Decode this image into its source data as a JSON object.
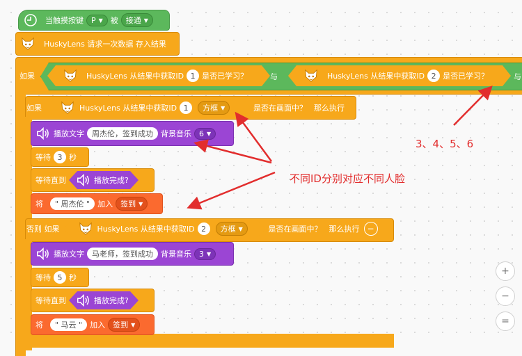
{
  "event_block": {
    "prefix": "当触摸按键",
    "key": "P",
    "middle": "被",
    "state": "接通"
  },
  "request_block": {
    "label": "HuskyLens 请求一次数据 存入结果"
  },
  "outer_if": {
    "if_label": "如果",
    "cond1": {
      "label": "HuskyLens 从结果中获取ID",
      "id": "1",
      "suffix": "是否已学习？"
    },
    "and_label": "与",
    "cond2": {
      "label": "HuskyLens 从结果中获取ID",
      "id": "2",
      "suffix": "是否已学习？"
    },
    "and_label_2": "与"
  },
  "inner_if": {
    "if_label": "如果",
    "label": "HuskyLens 从结果中获取ID",
    "id": "1",
    "shape": "方框",
    "suffix": "是否在画面中？",
    "then": "那么执行"
  },
  "play1": {
    "label": "播放文字",
    "text": "周杰伦，签到成功",
    "music_label": "背景音乐",
    "music": "6"
  },
  "wait1": {
    "label": "等待",
    "value": "3",
    "unit": "秒"
  },
  "wait_until1": {
    "label": "等待直到",
    "cond": "播放完成?"
  },
  "add1": {
    "label": "将",
    "value": "\" 周杰伦 \"",
    "join": "加入",
    "list": "签到"
  },
  "else_if": {
    "label_prefix": "否则 如果",
    "label": "HuskyLens 从结果中获取ID",
    "id": "2",
    "shape": "方框",
    "suffix": "是否在画面中？",
    "then": "那么执行"
  },
  "play2": {
    "label": "播放文字",
    "text": "马老师，签到成功",
    "music_label": "背景音乐",
    "music": "3"
  },
  "wait2": {
    "label": "等待",
    "value": "5",
    "unit": "秒"
  },
  "wait_until2": {
    "label": "等待直到",
    "cond": "播放完成?"
  },
  "add2": {
    "label": "将",
    "value": "\" 马云 \"",
    "join": "加入",
    "list": "签到"
  },
  "annotations": {
    "ids_note": "3、4、5、6",
    "faces_note": "不同ID分别对应不同人脸"
  },
  "zoom": {
    "in": "+",
    "out": "−",
    "reset": "="
  }
}
